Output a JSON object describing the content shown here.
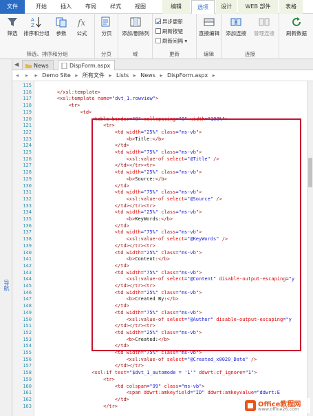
{
  "ribbon_tabs": [
    {
      "label": "文件",
      "kind": "file"
    },
    {
      "label": "开始",
      "kind": "normal"
    },
    {
      "label": "插入",
      "kind": "normal"
    },
    {
      "label": "布局",
      "kind": "normal"
    },
    {
      "label": "样式",
      "kind": "normal"
    },
    {
      "label": "视图",
      "kind": "normal"
    },
    {
      "label": "编辑",
      "kind": "ctx"
    },
    {
      "label": "选项",
      "kind": "active"
    },
    {
      "label": "设计",
      "kind": "ctx"
    },
    {
      "label": "WEB 部件",
      "kind": "ctx"
    },
    {
      "label": "表格",
      "kind": "ctx"
    }
  ],
  "ribbon": {
    "filter": "筛选",
    "sort_group": "排序和分组",
    "params": "参数",
    "formula": "公式",
    "group1_label": "筛选、排序和分组",
    "paging": "分页",
    "group2_label": "分页",
    "add_remove_cols": "添加/删除列",
    "group3_label": "域",
    "async_update": "异步更新",
    "refresh_button": "刷新按钮",
    "refresh_interval": "刷新间隔",
    "group4_label": "更新",
    "inline_edit": "直接编辑",
    "group5_label": "编辑",
    "add_connection": "添加连接",
    "manage_connections": "管理连接",
    "group6_label": "连接",
    "refresh_data": "刷新数据"
  },
  "doc_tabs": [
    "News",
    "DispForm.aspx"
  ],
  "breadcrumb": [
    "Demo Site",
    "所有文件",
    "Lists",
    "News",
    "DispForm.aspx"
  ],
  "nav_label": "导航",
  "code_lines": [
    {
      "n": "115",
      "indent": 0,
      "html": ""
    },
    {
      "n": "116",
      "indent": 4,
      "html": "<span class=\"t\">&lt;/xsl:template&gt;</span>"
    },
    {
      "n": "117",
      "indent": 4,
      "html": "<span class=\"t\">&lt;xsl:template</span> <span class=\"a\">name</span><span class=\"p\">=</span><span class=\"v\">\"dvt_1.rowview\"</span><span class=\"t\">&gt;</span>"
    },
    {
      "n": "118",
      "indent": 8,
      "html": "<span class=\"t\">&lt;tr&gt;</span>"
    },
    {
      "n": "119",
      "indent": 12,
      "html": "<span class=\"t\">&lt;td&gt;</span>"
    },
    {
      "n": "120",
      "indent": 16,
      "html": "<span class=\"t\">&lt;table</span> <span class=\"a\">border</span><span class=\"p\">=</span><span class=\"v\">\"0\"</span> <span class=\"a\">cellspacing</span><span class=\"p\">=</span><span class=\"v\">\"0\"</span> <span class=\"a\">width</span><span class=\"p\">=</span><span class=\"v\">\"100%\"</span><span class=\"t\">&gt;</span>"
    },
    {
      "n": "121",
      "indent": 20,
      "html": "<span class=\"t\">&lt;tr&gt;</span>"
    },
    {
      "n": "122",
      "indent": 24,
      "html": "<span class=\"t\">&lt;td</span> <span class=\"a\">width</span><span class=\"p\">=</span><span class=\"v\">\"25%\"</span> <span class=\"a\">class</span><span class=\"p\">=</span><span class=\"v\">\"ms-vb\"</span><span class=\"t\">&gt;</span>"
    },
    {
      "n": "123",
      "indent": 28,
      "html": "<span class=\"t\">&lt;b&gt;</span><span class=\"x\">Title:</span><span class=\"t\">&lt;/b&gt;</span>"
    },
    {
      "n": "124",
      "indent": 24,
      "html": "<span class=\"t\">&lt;/td&gt;</span>"
    },
    {
      "n": "125",
      "indent": 24,
      "html": "<span class=\"t\">&lt;td</span> <span class=\"a\">width</span><span class=\"p\">=</span><span class=\"v\">\"75%\"</span> <span class=\"a\">class</span><span class=\"p\">=</span><span class=\"v\">\"ms-vb\"</span><span class=\"t\">&gt;</span>"
    },
    {
      "n": "126",
      "indent": 28,
      "html": "<span class=\"t\">&lt;xsl:value-of</span> <span class=\"a\">select</span><span class=\"p\">=</span><span class=\"v\">\"@Title\"</span> <span class=\"t\">/&gt;</span>"
    },
    {
      "n": "127",
      "indent": 24,
      "html": "<span class=\"t\">&lt;/td&gt;&lt;/tr&gt;&lt;tr&gt;</span>"
    },
    {
      "n": "128",
      "indent": 24,
      "html": "<span class=\"t\">&lt;td</span> <span class=\"a\">width</span><span class=\"p\">=</span><span class=\"v\">\"25%\"</span> <span class=\"a\">class</span><span class=\"p\">=</span><span class=\"v\">\"ms-vb\"</span><span class=\"t\">&gt;</span>"
    },
    {
      "n": "129",
      "indent": 28,
      "html": "<span class=\"t\">&lt;b&gt;</span><span class=\"x\">Source:</span><span class=\"t\">&lt;/b&gt;</span>"
    },
    {
      "n": "130",
      "indent": 24,
      "html": "<span class=\"t\">&lt;/td&gt;</span>"
    },
    {
      "n": "131",
      "indent": 24,
      "html": "<span class=\"t\">&lt;td</span> <span class=\"a\">width</span><span class=\"p\">=</span><span class=\"v\">\"75%\"</span> <span class=\"a\">class</span><span class=\"p\">=</span><span class=\"v\">\"ms-vb\"</span><span class=\"t\">&gt;</span>"
    },
    {
      "n": "132",
      "indent": 28,
      "html": "<span class=\"t\">&lt;xsl:value-of</span> <span class=\"a\">select</span><span class=\"p\">=</span><span class=\"v\">\"@Source\"</span> <span class=\"t\">/&gt;</span>"
    },
    {
      "n": "133",
      "indent": 24,
      "html": "<span class=\"t\">&lt;/td&gt;&lt;/tr&gt;&lt;tr&gt;</span>"
    },
    {
      "n": "134",
      "indent": 24,
      "html": "<span class=\"t\">&lt;td</span> <span class=\"a\">width</span><span class=\"p\">=</span><span class=\"v\">\"25%\"</span> <span class=\"a\">class</span><span class=\"p\">=</span><span class=\"v\">\"ms-vb\"</span><span class=\"t\">&gt;</span>"
    },
    {
      "n": "135",
      "indent": 28,
      "html": "<span class=\"t\">&lt;b&gt;</span><span class=\"x\">KeyWords:</span><span class=\"t\">&lt;/b&gt;</span>"
    },
    {
      "n": "136",
      "indent": 24,
      "html": "<span class=\"t\">&lt;/td&gt;</span>"
    },
    {
      "n": "137",
      "indent": 24,
      "html": "<span class=\"t\">&lt;td</span> <span class=\"a\">width</span><span class=\"p\">=</span><span class=\"v\">\"75%\"</span> <span class=\"a\">class</span><span class=\"p\">=</span><span class=\"v\">\"ms-vb\"</span><span class=\"t\">&gt;</span>"
    },
    {
      "n": "138",
      "indent": 28,
      "html": "<span class=\"t\">&lt;xsl:value-of</span> <span class=\"a\">select</span><span class=\"p\">=</span><span class=\"v\">\"@KeyWords\"</span> <span class=\"t\">/&gt;</span>"
    },
    {
      "n": "139",
      "indent": 24,
      "html": "<span class=\"t\">&lt;/td&gt;&lt;/tr&gt;&lt;tr&gt;</span>"
    },
    {
      "n": "140",
      "indent": 24,
      "html": "<span class=\"t\">&lt;td</span> <span class=\"a\">width</span><span class=\"p\">=</span><span class=\"v\">\"25%\"</span> <span class=\"a\">class</span><span class=\"p\">=</span><span class=\"v\">\"ms-vb\"</span><span class=\"t\">&gt;</span>"
    },
    {
      "n": "141",
      "indent": 28,
      "html": "<span class=\"t\">&lt;b&gt;</span><span class=\"x\">Content:</span><span class=\"t\">&lt;/b&gt;</span>"
    },
    {
      "n": "142",
      "indent": 24,
      "html": "<span class=\"t\">&lt;/td&gt;</span>"
    },
    {
      "n": "143",
      "indent": 24,
      "html": "<span class=\"t\">&lt;td</span> <span class=\"a\">width</span><span class=\"p\">=</span><span class=\"v\">\"75%\"</span> <span class=\"a\">class</span><span class=\"p\">=</span><span class=\"v\">\"ms-vb\"</span><span class=\"t\">&gt;</span>"
    },
    {
      "n": "144",
      "indent": 28,
      "html": "<span class=\"t\">&lt;xsl:value-of</span> <span class=\"a\">select</span><span class=\"p\">=</span><span class=\"v\">\"@Content\"</span> <span class=\"a\">disable-output-escaping</span><span class=\"p\">=</span><span class=\"v\">\"y</span>"
    },
    {
      "n": "145",
      "indent": 24,
      "html": "<span class=\"t\">&lt;/td&gt;&lt;/tr&gt;&lt;tr&gt;</span>"
    },
    {
      "n": "146",
      "indent": 24,
      "html": "<span class=\"t\">&lt;td</span> <span class=\"a\">width</span><span class=\"p\">=</span><span class=\"v\">\"25%\"</span> <span class=\"a\">class</span><span class=\"p\">=</span><span class=\"v\">\"ms-vb\"</span><span class=\"t\">&gt;</span>"
    },
    {
      "n": "147",
      "indent": 28,
      "html": "<span class=\"t\">&lt;b&gt;</span><span class=\"x\">Created By:</span><span class=\"t\">&lt;/b&gt;</span>"
    },
    {
      "n": "148",
      "indent": 24,
      "html": "<span class=\"t\">&lt;/td&gt;</span>"
    },
    {
      "n": "149",
      "indent": 24,
      "html": "<span class=\"t\">&lt;td</span> <span class=\"a\">width</span><span class=\"p\">=</span><span class=\"v\">\"75%\"</span> <span class=\"a\">class</span><span class=\"p\">=</span><span class=\"v\">\"ms-vb\"</span><span class=\"t\">&gt;</span>"
    },
    {
      "n": "150",
      "indent": 28,
      "html": "<span class=\"t\">&lt;xsl:value-of</span> <span class=\"a\">select</span><span class=\"p\">=</span><span class=\"v\">\"@Author\"</span> <span class=\"a\">disable-output-escaping</span><span class=\"p\">=</span><span class=\"v\">\"y</span>"
    },
    {
      "n": "151",
      "indent": 24,
      "html": "<span class=\"t\">&lt;/td&gt;&lt;/tr&gt;&lt;tr&gt;</span>"
    },
    {
      "n": "152",
      "indent": 24,
      "html": "<span class=\"t\">&lt;td</span> <span class=\"a\">width</span><span class=\"p\">=</span><span class=\"v\">\"25%\"</span> <span class=\"a\">class</span><span class=\"p\">=</span><span class=\"v\">\"ms-vb\"</span><span class=\"t\">&gt;</span>"
    },
    {
      "n": "153",
      "indent": 28,
      "html": "<span class=\"t\">&lt;b&gt;</span><span class=\"x\">Created:</span><span class=\"t\">&lt;/b&gt;</span>"
    },
    {
      "n": "154",
      "indent": 24,
      "html": "<span class=\"t\">&lt;/td&gt;</span>"
    },
    {
      "n": "155",
      "indent": 24,
      "html": "<span class=\"t\">&lt;td</span> <span class=\"a\">width</span><span class=\"p\">=</span><span class=\"v\">\"75%\"</span> <span class=\"a\">class</span><span class=\"p\">=</span><span class=\"v\">\"ms-vb\"</span><span class=\"t\">&gt;</span>"
    },
    {
      "n": "156",
      "indent": 28,
      "html": "<span class=\"t\">&lt;xsl:value-of</span> <span class=\"a\">select</span><span class=\"p\">=</span><span class=\"v\">\"@Created_x0020_Date\"</span> <span class=\"t\">/&gt;</span>"
    },
    {
      "n": "157",
      "indent": 24,
      "html": "<span class=\"t\">&lt;/td&gt;&lt;/tr&gt;</span>"
    },
    {
      "n": "158",
      "indent": 16,
      "html": "<span class=\"t\">&lt;xsl:if</span> <span class=\"a\">test</span><span class=\"p\">=</span><span class=\"v\">\"$dvt_1_automode = '1'\"</span> <span class=\"a\">ddwrt:cf_ignore</span><span class=\"p\">=</span><span class=\"v\">\"1\"</span><span class=\"t\">&gt;</span>"
    },
    {
      "n": "159",
      "indent": 20,
      "html": "<span class=\"t\">&lt;tr&gt;</span>"
    },
    {
      "n": "160",
      "indent": 24,
      "html": "<span class=\"t\">&lt;td</span> <span class=\"a\">colspan</span><span class=\"p\">=</span><span class=\"v\">\"99\"</span> <span class=\"a\">class</span><span class=\"p\">=</span><span class=\"v\">\"ms-vb\"</span><span class=\"t\">&gt;</span>"
    },
    {
      "n": "161",
      "indent": 28,
      "html": "<span class=\"t\">&lt;span</span> <span class=\"a\">ddwrt:amkeyfield</span><span class=\"p\">=</span><span class=\"v\">\"ID\"</span> <span class=\"a\">ddwrt:amkeyvalue</span><span class=\"p\">=</span><span class=\"v\">\"ddwrt:E</span>"
    },
    {
      "n": "162",
      "indent": 24,
      "html": "<span class=\"t\">&lt;/td&gt;</span>"
    },
    {
      "n": "163",
      "indent": 20,
      "html": "<span class=\"t\">&lt;/tr&gt;</span>"
    }
  ],
  "scrollbar": {
    "position": 0.25,
    "visible_fraction": 0.09
  },
  "watermark": {
    "title": "Office教程网",
    "url": "www.office26.com"
  },
  "colors": {
    "file_tab": "#2b6cc4",
    "highlight_box": "#c8102e",
    "tag": "#a31515",
    "attr": "#e00000",
    "value": "#1a1ad0",
    "line_number": "#2b91af"
  }
}
